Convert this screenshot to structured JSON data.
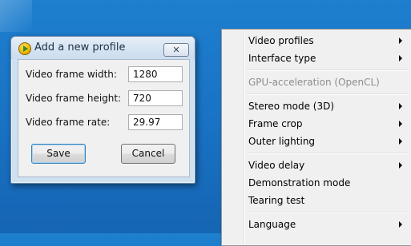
{
  "dialog": {
    "title": "Add a new profile",
    "close_label": "✕",
    "fields": [
      {
        "label": "Video frame width:",
        "value": "1280"
      },
      {
        "label": "Video frame height:",
        "value": "720"
      },
      {
        "label": "Video frame rate:",
        "value": "29.97"
      }
    ],
    "save_label": "Save",
    "cancel_label": "Cancel"
  },
  "menu": {
    "items": [
      {
        "label": "Video profiles",
        "submenu": true,
        "enabled": true
      },
      {
        "label": "Interface type",
        "submenu": true,
        "enabled": true
      },
      {
        "label": "GPU-acceleration (OpenCL)",
        "submenu": false,
        "enabled": false
      },
      {
        "label": "Stereo mode (3D)",
        "submenu": true,
        "enabled": true
      },
      {
        "label": "Frame crop",
        "submenu": true,
        "enabled": true
      },
      {
        "label": "Outer lighting",
        "submenu": true,
        "enabled": true
      },
      {
        "label": "Video delay",
        "submenu": true,
        "enabled": true
      },
      {
        "label": "Demonstration mode",
        "submenu": false,
        "enabled": true
      },
      {
        "label": "Tearing test",
        "submenu": false,
        "enabled": true
      },
      {
        "label": "Language",
        "submenu": true,
        "enabled": true
      }
    ]
  }
}
